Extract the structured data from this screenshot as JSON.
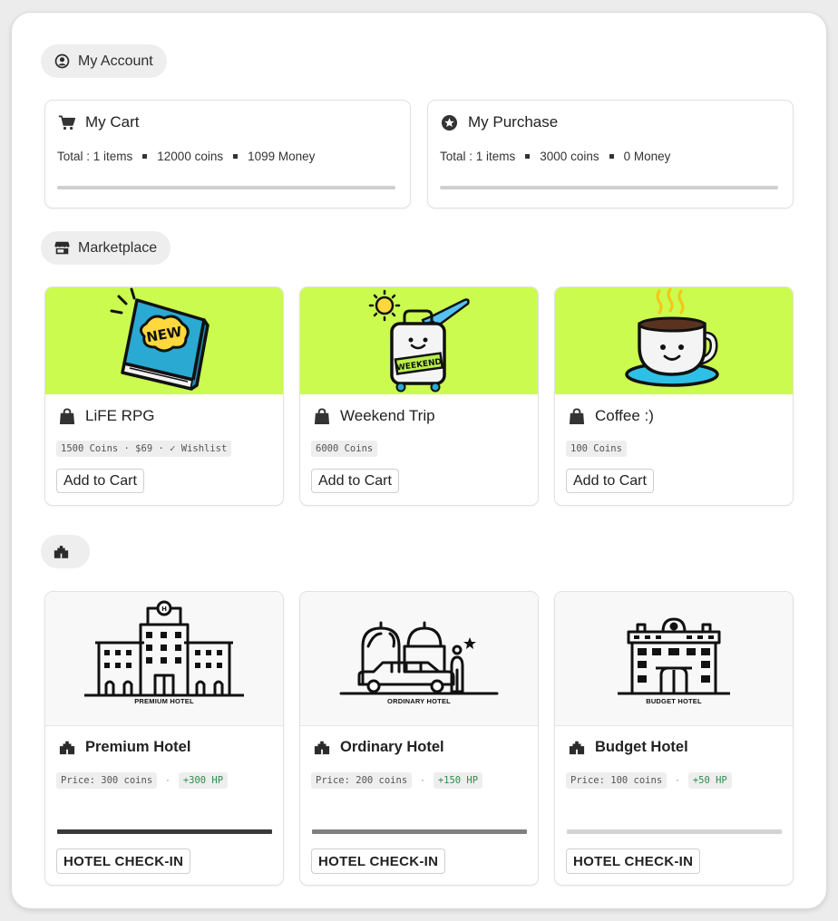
{
  "account_section": {
    "label": "My Account",
    "icon": "user-circle-icon"
  },
  "cart": {
    "title": "My Cart",
    "icon": "cart-icon",
    "items": "Total : 1 items",
    "coins": "12000 coins",
    "money": "1099 Money"
  },
  "purchase": {
    "title": "My Purchase",
    "icon": "star-circle-icon",
    "items": "Total : 1 items",
    "coins": "3000 coins",
    "money": "0 Money"
  },
  "marketplace_section": {
    "label": "Marketplace",
    "icon": "store-icon"
  },
  "products": [
    {
      "name": "LiFE RPG",
      "tag": "1500 Coins · $69 · ✓ Wishlist",
      "button": "Add to Cart",
      "image": "new-book-image",
      "image_text": "NEW"
    },
    {
      "name": "Weekend Trip",
      "tag": "6000 Coins",
      "button": "Add to Cart",
      "image": "weekend-suitcase-image",
      "image_text": "WEEKEND"
    },
    {
      "name": "Coffee :)",
      "tag": "100 Coins",
      "button": "Add to Cart",
      "image": "coffee-cup-image"
    }
  ],
  "hotels_section": {
    "label": "",
    "icon": "hotel-icon"
  },
  "hotels": [
    {
      "name": "Premium Hotel",
      "caption": "PREMIUM HOTEL",
      "price": "Price: 300 coins",
      "separator": "·",
      "hp": "+300 HP",
      "button": "HOTEL CHECK-IN",
      "bar_color": "#3a3a3a"
    },
    {
      "name": "Ordinary Hotel",
      "caption": "ORDINARY HOTEL",
      "price": "Price: 200 coins",
      "separator": "·",
      "hp": "+150 HP",
      "button": "HOTEL CHECK-IN",
      "bar_color": "#808080"
    },
    {
      "name": "Budget Hotel",
      "caption": "BUDGET HOTEL",
      "price": "Price: 100 coins",
      "separator": "·",
      "hp": "+50 HP",
      "button": "HOTEL CHECK-IN",
      "bar_color": "#d4d4d4"
    }
  ],
  "colors": {
    "hero_bg": "#cbfb4f",
    "hp_green": "#2e8b4b",
    "pill_bg": "#eeeeee"
  }
}
